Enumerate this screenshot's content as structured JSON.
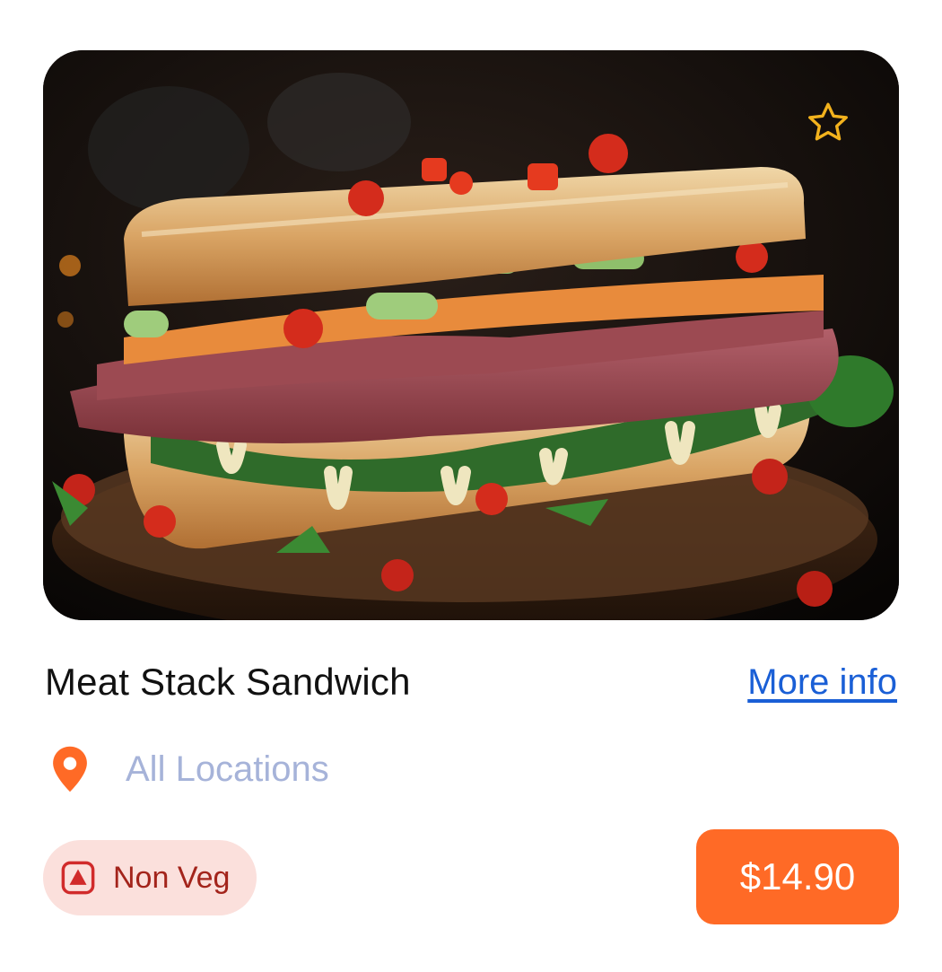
{
  "product": {
    "name": "Meat Stack Sandwich",
    "more_info_label": "More info",
    "location_label": "All Locations",
    "diet_label": "Non Veg",
    "price_label": "$14.90"
  },
  "icons": {
    "favorite": "star-outline-icon",
    "location": "map-pin-icon",
    "diet": "non-veg-triangle-icon"
  },
  "colors": {
    "accent": "#ff6a26",
    "link": "#1a5fd6",
    "star": "#f2b21d",
    "location_text": "#a6b3d9",
    "badge_bg": "#fbe0dc",
    "badge_text": "#a3241b"
  }
}
